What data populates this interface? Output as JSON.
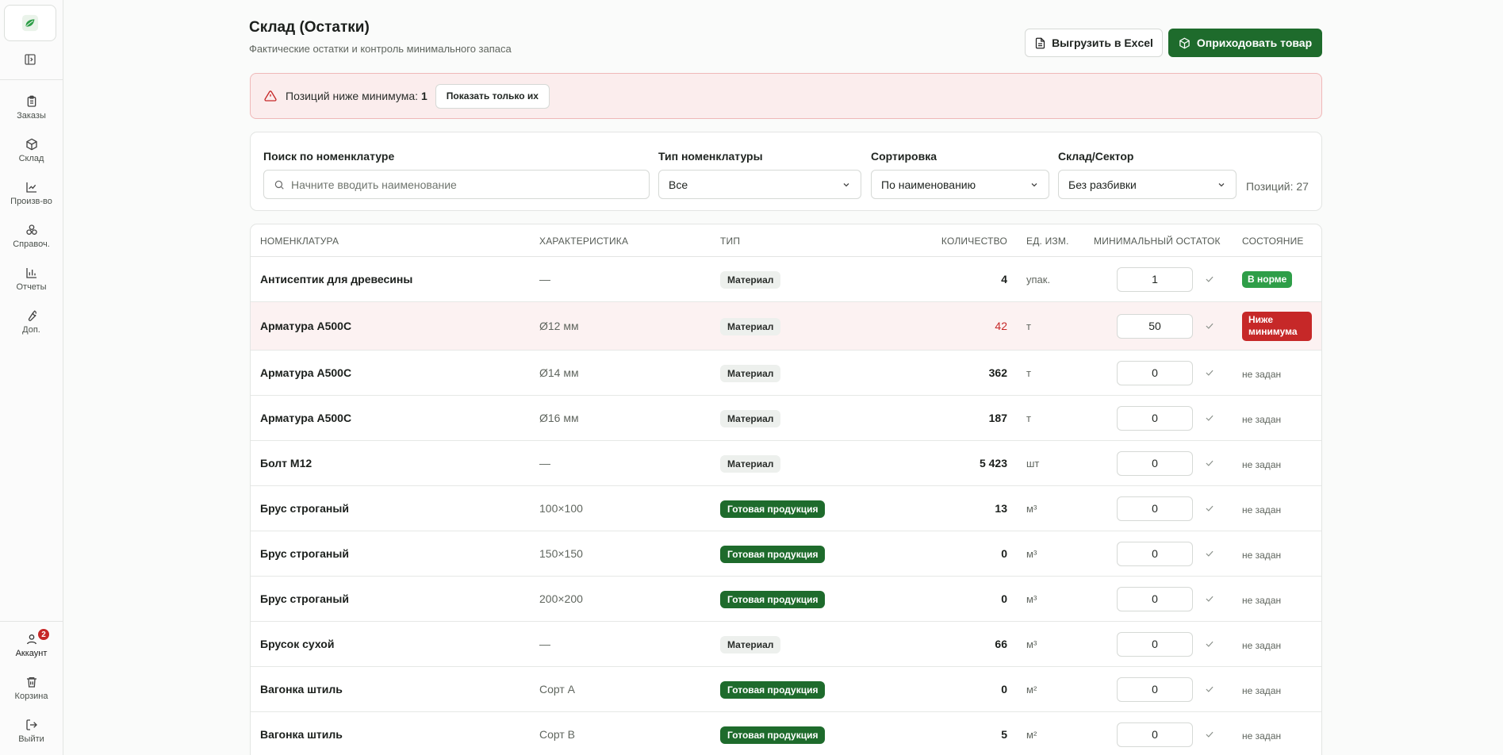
{
  "sidebar": {
    "logo_icon": "leaf-icon",
    "items": [
      {
        "name": "orders",
        "label": "Заказы",
        "icon": "clipboard-icon"
      },
      {
        "name": "warehouse",
        "label": "Склад",
        "icon": "box-icon"
      },
      {
        "name": "production",
        "label": "Произв-во",
        "icon": "chart-icon"
      },
      {
        "name": "reference",
        "label": "Справоч.",
        "icon": "boxes-icon"
      },
      {
        "name": "reports",
        "label": "Отчеты",
        "icon": "bar-chart-icon"
      },
      {
        "name": "extra",
        "label": "Доп.",
        "icon": "wrench-icon"
      }
    ],
    "bottom": [
      {
        "name": "account",
        "label": "Аккаунт",
        "icon": "user-icon",
        "badge": "2"
      },
      {
        "name": "trash",
        "label": "Корзина",
        "icon": "trash-icon"
      },
      {
        "name": "logout",
        "label": "Выйти",
        "icon": "logout-icon"
      }
    ]
  },
  "header": {
    "title": "Склад (Остатки)",
    "subtitle": "Фактические остатки и контроль минимального запаса",
    "export_label": "Выгрузить в Excel",
    "receive_label": "Оприходовать товар"
  },
  "alert": {
    "text": "Позиций ниже минимума:",
    "count": "1",
    "button_label": "Показать только их"
  },
  "filters": {
    "search_label": "Поиск по номенклатуре",
    "search_placeholder": "Начните вводить наименование",
    "type_label": "Тип номенклатуры",
    "type_value": "Все",
    "sort_label": "Сортировка",
    "sort_value": "По наименованию",
    "warehouse_label": "Склад/Сектор",
    "warehouse_value": "Без разбивки",
    "positions_text": "Позиций: 27"
  },
  "table": {
    "columns": {
      "name": "Номенклатура",
      "characteristic": "Характеристика",
      "type": "Тип",
      "quantity": "Количество",
      "unit": "Ед. изм.",
      "min_stock": "Минимальный остаток",
      "state": "Состояние"
    },
    "rows": [
      {
        "name": "Антисептик для древесины",
        "characteristic": "—",
        "type": "Материал",
        "type_kind": "material",
        "quantity": "4",
        "unit": "упак.",
        "min": "1",
        "state": "В норме",
        "state_kind": "ok"
      },
      {
        "name": "Арматура А500С",
        "characteristic": "Ø12 мм",
        "type": "Материал",
        "type_kind": "material",
        "quantity": "42",
        "unit": "т",
        "min": "50",
        "state": "Ниже минимума",
        "state_kind": "low"
      },
      {
        "name": "Арматура А500С",
        "characteristic": "Ø14 мм",
        "type": "Материал",
        "type_kind": "material",
        "quantity": "362",
        "unit": "т",
        "min": "0",
        "state": "не задан",
        "state_kind": "none"
      },
      {
        "name": "Арматура А500С",
        "characteristic": "Ø16 мм",
        "type": "Материал",
        "type_kind": "material",
        "quantity": "187",
        "unit": "т",
        "min": "0",
        "state": "не задан",
        "state_kind": "none"
      },
      {
        "name": "Болт М12",
        "characteristic": "—",
        "type": "Материал",
        "type_kind": "material",
        "quantity": "5 423",
        "unit": "шт",
        "min": "0",
        "state": "не задан",
        "state_kind": "none"
      },
      {
        "name": "Брус строганый",
        "characteristic": "100×100",
        "type": "Готовая продукция",
        "type_kind": "product",
        "quantity": "13",
        "unit": "м³",
        "min": "0",
        "state": "не задан",
        "state_kind": "none"
      },
      {
        "name": "Брус строганый",
        "characteristic": "150×150",
        "type": "Готовая продукция",
        "type_kind": "product",
        "quantity": "0",
        "unit": "м³",
        "min": "0",
        "state": "не задан",
        "state_kind": "none"
      },
      {
        "name": "Брус строганый",
        "characteristic": "200×200",
        "type": "Готовая продукция",
        "type_kind": "product",
        "quantity": "0",
        "unit": "м³",
        "min": "0",
        "state": "не задан",
        "state_kind": "none"
      },
      {
        "name": "Брусок сухой",
        "characteristic": "—",
        "type": "Материал",
        "type_kind": "material",
        "quantity": "66",
        "unit": "м³",
        "min": "0",
        "state": "не задан",
        "state_kind": "none"
      },
      {
        "name": "Вагонка штиль",
        "characteristic": "Сорт А",
        "type": "Готовая продукция",
        "type_kind": "product",
        "quantity": "0",
        "unit": "м²",
        "min": "0",
        "state": "не задан",
        "state_kind": "none"
      },
      {
        "name": "Вагонка штиль",
        "characteristic": "Сорт В",
        "type": "Готовая продукция",
        "type_kind": "product",
        "quantity": "5",
        "unit": "м²",
        "min": "0",
        "state": "не задан",
        "state_kind": "none"
      }
    ]
  },
  "colors": {
    "brand_green": "#1e6b2c",
    "ok_green": "#2e9e48",
    "danger_red": "#c62828",
    "alert_bg": "#fbeded"
  }
}
